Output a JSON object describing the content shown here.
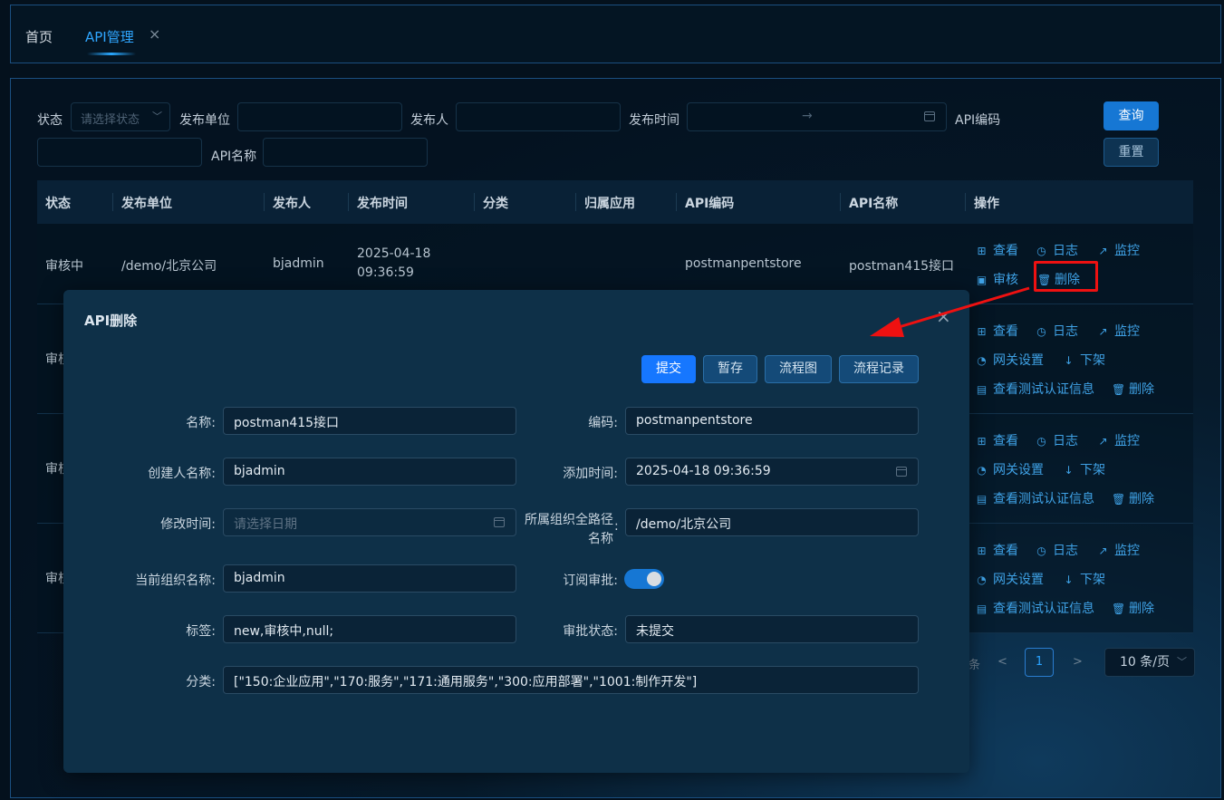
{
  "tabs": {
    "home": "首页",
    "api": "API管理",
    "close_symbol": "×"
  },
  "filters": {
    "status_label": "状态",
    "status_placeholder": "请选择状态",
    "unit_label": "发布单位",
    "publisher_label": "发布人",
    "time_label": "发布时间",
    "range_arrow": "→",
    "code_label": "API编码",
    "name_label": "API名称",
    "query_button": "查询",
    "reset_button": "重置"
  },
  "table": {
    "headers": [
      "状态",
      "发布单位",
      "发布人",
      "发布时间",
      "分类",
      "归属应用",
      "API编码",
      "API名称",
      "操作"
    ],
    "row1": {
      "status": "审核中",
      "unit": "/demo/北京公司",
      "publisher": "bjadmin",
      "date": "2025-04-18",
      "time": "09:36:59",
      "code": "postmanpentstore",
      "name": "postman415接口"
    },
    "partial_status": "审核",
    "ops": {
      "view": "查看",
      "log": "日志",
      "monitor": "监控",
      "review": "审核",
      "delete": "删除",
      "gateway": "网关设置",
      "offline": "下架",
      "auth_info": "查看测试认证信息"
    }
  },
  "pager": {
    "items_suffix": "条",
    "prev": "<",
    "current_page": "1",
    "next": ">",
    "page_size": "10 条/页"
  },
  "modal": {
    "title": "API删除",
    "close_symbol": "×",
    "buttons": {
      "submit": "提交",
      "save_draft": "暂存",
      "flowchart": "流程图",
      "flow_record": "流程记录"
    },
    "fields": {
      "name_label": "名称:",
      "name_value": "postman415接口",
      "code_label": "编码:",
      "code_value": "postmanpentstore",
      "creator_label": "创建人名称:",
      "creator_value": "bjadmin",
      "added_time_label": "添加时间:",
      "added_time_value": "2025-04-18 09:36:59",
      "modify_time_label": "修改时间:",
      "modify_time_placeholder": "请选择日期",
      "org_path_label_line1": "所属组织全路径",
      "org_path_label_line2": "名称",
      "org_path_colon": ":",
      "org_path_value": "/demo/北京公司",
      "current_org_label": "当前组织名称:",
      "current_org_value": "bjadmin",
      "subscribe_label": "订阅审批:",
      "subscribe_enabled": true,
      "tags_label": "标签:",
      "tags_value": "new,审核中,null;",
      "approval_status_label": "审批状态:",
      "approval_status_value": "未提交",
      "category_label": "分类:",
      "category_value": "[\"150:企业应用\",\"170:服务\",\"171:通用服务\",\"300:应用部署\",\"1001:制作开发\"]"
    }
  },
  "colors": {
    "accent": "#1677ff",
    "link": "#3fa2e6",
    "annotation": "#ee1111"
  }
}
